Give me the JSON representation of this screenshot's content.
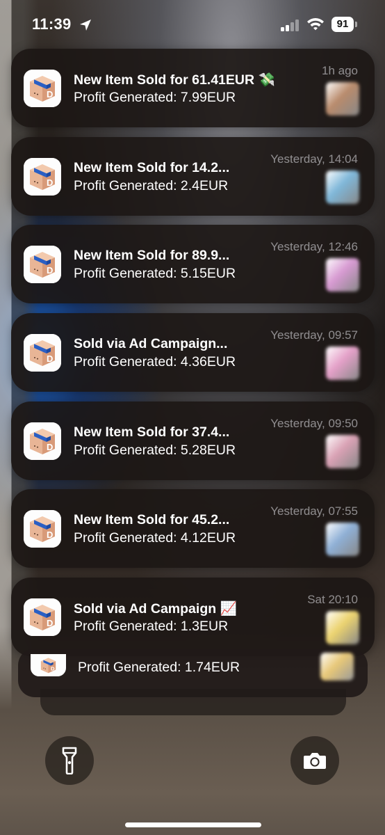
{
  "status_bar": {
    "time": "11:39",
    "battery": "91",
    "location_icon": "location-arrow-icon",
    "signal_icon": "cellular-signal-icon",
    "wifi_icon": "wifi-icon"
  },
  "app": {
    "icon": "shipping-box-app-icon",
    "colors": {
      "box": "#e8b596",
      "tape": "#2a5fc4",
      "icon_bg": "#fdfdfd"
    }
  },
  "notifications": [
    {
      "title": "New Item Sold for 61.41EUR",
      "emoji": "💸",
      "body": "Profit Generated: 7.99EUR",
      "time": "1h ago",
      "thumb_color": "#b98b6c"
    },
    {
      "title": "New Item Sold for 14.2...",
      "emoji": "",
      "body": "Profit Generated: 2.4EUR",
      "time": "Yesterday, 14:04",
      "thumb_color": "#7fb7d9"
    },
    {
      "title": "New Item Sold for 89.9...",
      "emoji": "",
      "body": "Profit Generated: 5.15EUR",
      "time": "Yesterday, 12:46",
      "thumb_color": "#d79ad2"
    },
    {
      "title": "Sold via Ad Campaign...",
      "emoji": "",
      "body": "Profit Generated: 4.36EUR",
      "time": "Yesterday, 09:57",
      "thumb_color": "#e4a0c8"
    },
    {
      "title": "New Item Sold for 37.4...",
      "emoji": "",
      "body": "Profit Generated: 5.28EUR",
      "time": "Yesterday, 09:50",
      "thumb_color": "#d9a1b4"
    },
    {
      "title": "New Item Sold for 45.2...",
      "emoji": "",
      "body": "Profit Generated: 4.12EUR",
      "time": "Yesterday, 07:55",
      "thumb_color": "#8fb0d6"
    },
    {
      "title": "Sold via Ad Campaign",
      "emoji": "📈",
      "body": "Profit Generated: 1.3EUR",
      "time": "Sat 20:10",
      "thumb_color": "#ecd36f"
    }
  ],
  "stacked": {
    "body": "Profit Generated: 1.74EUR",
    "thumb_color": "#e8c878"
  },
  "lock_buttons": {
    "flashlight_icon": "flashlight-icon",
    "camera_icon": "camera-icon"
  }
}
